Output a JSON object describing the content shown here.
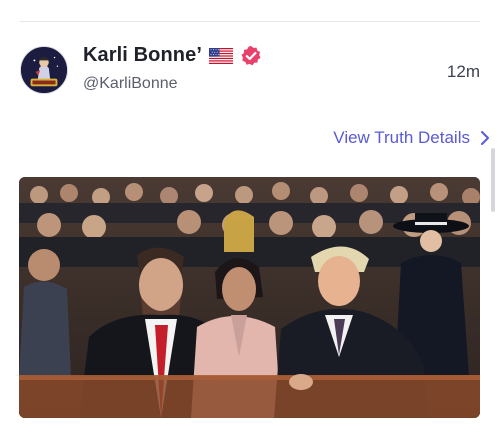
{
  "post": {
    "author": {
      "display_name": "Karli Bonne’",
      "handle": "@KarliBonne",
      "flag_icon": "us-flag-icon",
      "verified_icon": "verified-badge-icon",
      "verified_color": "#e8416b"
    },
    "timestamp": "12m",
    "details_link": "View Truth Details",
    "link_color": "#5a5ad6"
  }
}
